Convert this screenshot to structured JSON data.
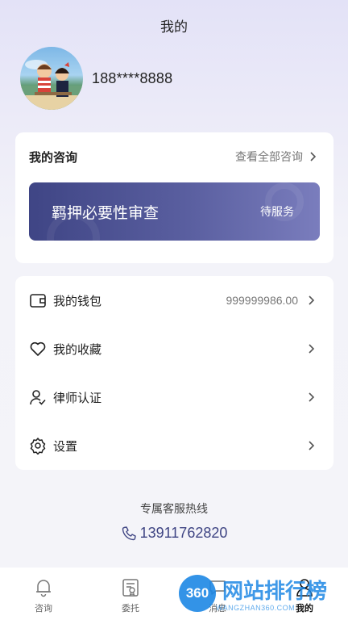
{
  "header": {
    "title": "我的"
  },
  "profile": {
    "phone": "188****8888"
  },
  "consult": {
    "title": "我的咨询",
    "view_all": "查看全部咨询",
    "item": {
      "name": "羁押必要性审查",
      "status": "待服务"
    }
  },
  "menu": {
    "items": [
      {
        "label": "我的钱包",
        "value": "999999986.00",
        "icon": "wallet-icon"
      },
      {
        "label": "我的收藏",
        "value": "",
        "icon": "heart-icon"
      },
      {
        "label": "律师认证",
        "value": "",
        "icon": "user-verify-icon"
      },
      {
        "label": "设置",
        "value": "",
        "icon": "gear-icon"
      }
    ]
  },
  "hotline": {
    "caption": "专属客服热线",
    "number": "13911762820"
  },
  "tabs": [
    {
      "label": "咨询",
      "icon": "bell-icon"
    },
    {
      "label": "委托",
      "icon": "document-icon"
    },
    {
      "label": "消息",
      "icon": "message-icon"
    },
    {
      "label": "我的",
      "icon": "profile-icon",
      "active": true
    }
  ],
  "watermark": {
    "logo": "360",
    "text": "网站排行榜",
    "sub": "WANGZHAN360.COM"
  },
  "colors": {
    "accent": "#3e4483",
    "card_gradient_start": "#3f4585",
    "card_gradient_end": "#7a7dbd"
  }
}
